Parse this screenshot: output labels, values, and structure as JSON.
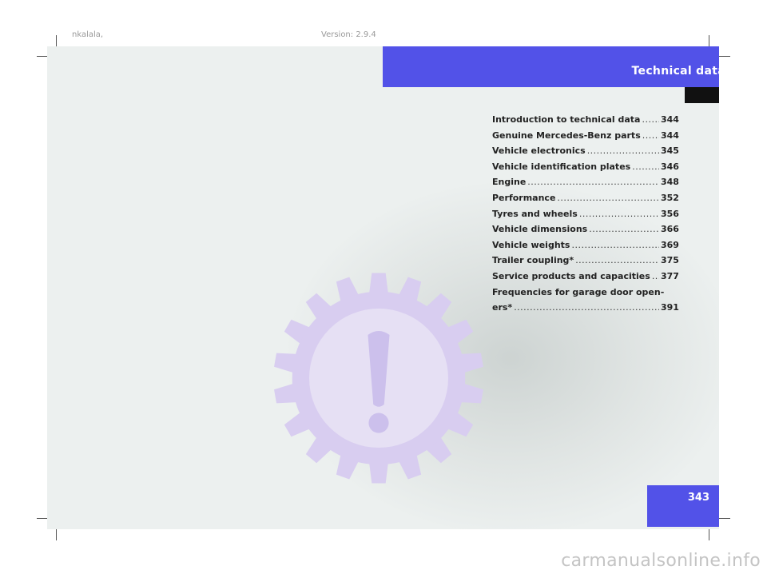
{
  "header": {
    "file_name": "nkalala,",
    "version": "Version: 2.9.4"
  },
  "section": {
    "title": "Technical data"
  },
  "page_number": "343",
  "toc": {
    "entries": [
      {
        "label": "Introduction to technical data",
        "page": "344"
      },
      {
        "label": "Genuine Mercedes-Benz parts",
        "page": "344"
      },
      {
        "label": "Vehicle electronics",
        "page": "345"
      },
      {
        "label": "Vehicle identification plates",
        "page": "346"
      },
      {
        "label": "Engine",
        "page": "348"
      },
      {
        "label": "Performance",
        "page": "352"
      },
      {
        "label": "Tyres and wheels",
        "page": "356"
      },
      {
        "label": "Vehicle dimensions",
        "page": "366"
      },
      {
        "label": "Vehicle weights",
        "page": "369"
      },
      {
        "label": "Trailer coupling*",
        "page": "375"
      },
      {
        "label": "Service products and capacities",
        "page": "377"
      }
    ],
    "last_entry": {
      "line1": "Frequencies for garage door open-",
      "line2": "ers*",
      "page": "391"
    }
  },
  "icon": {
    "name": "gear-exclamation-icon"
  },
  "watermark": "carmanualsonline.info",
  "colors": {
    "accent": "#5252e8",
    "page_bg": "#ecf0ef",
    "gear": "#d8cdf0"
  }
}
